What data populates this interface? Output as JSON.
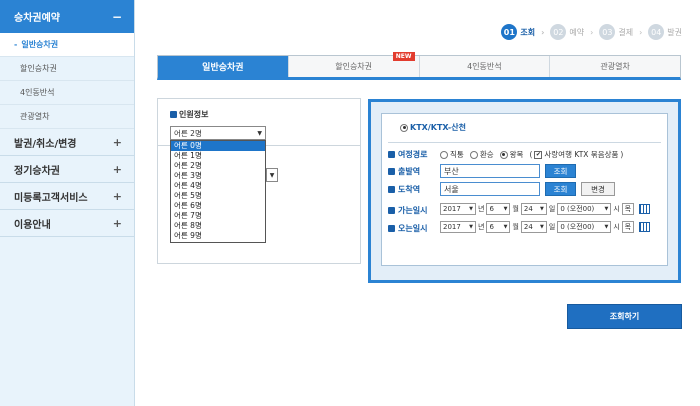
{
  "sidebar": {
    "header": {
      "label": "승차권예약",
      "sign": "−"
    },
    "subitems": [
      {
        "label": "일반승차권",
        "active": true
      },
      {
        "label": "할인승차권"
      },
      {
        "label": "4인동반석"
      },
      {
        "label": "관광열차"
      }
    ],
    "main_items": [
      {
        "label": "발권/취소/변경",
        "sign": "+"
      },
      {
        "label": "정기승차권",
        "sign": "+"
      },
      {
        "label": "미등록고객서비스",
        "sign": "+"
      },
      {
        "label": "이용안내",
        "sign": "+"
      }
    ]
  },
  "steps": [
    {
      "num": "01",
      "label": "조회",
      "active": true
    },
    {
      "num": "02",
      "label": "예약"
    },
    {
      "num": "03",
      "label": "결제"
    },
    {
      "num": "04",
      "label": "발권"
    }
  ],
  "step_arrow": "›",
  "tabs": [
    {
      "label": "일반승차권",
      "active": true
    },
    {
      "label": "할인승차권",
      "badge": "NEW"
    },
    {
      "label": "4인동반석"
    },
    {
      "label": "관광열차"
    }
  ],
  "passenger": {
    "title": "인원정보",
    "selected": "어른 2명",
    "options": [
      "어른 0명",
      "어른 1명",
      "어른 2명",
      "어른 3명",
      "어른 4명",
      "어른 5명",
      "어른 6명",
      "어른 7명",
      "어른 8명",
      "어른 9명"
    ],
    "highlighted_index": 0
  },
  "search_form": {
    "train_type": "KTX/KTX-산천",
    "route_label": "여정경로",
    "route_options": [
      "직통",
      "환승",
      "왕복"
    ],
    "route_selected": "왕복",
    "package_check_label": "사랑여행 KTX 묶음상품",
    "departure_label": "출발역",
    "departure_value": "부산",
    "arrival_label": "도착역",
    "arrival_value": "서울",
    "lookup_label": "조회",
    "change_label": "변경",
    "go_label": "가는일시",
    "return_label": "오는일시",
    "date_go": {
      "year": "2017",
      "month": "6",
      "day": "24",
      "hour": "0 (오전00)"
    },
    "date_return": {
      "year": "2017",
      "month": "6",
      "day": "24",
      "hour": "0 (오전00)"
    },
    "unit_year": "년",
    "unit_month": "월",
    "unit_day": "일",
    "unit_hour": "시",
    "weekday": "목"
  },
  "search_button": "조회하기",
  "colors": {
    "primary": "#2b83d3",
    "dark_blue": "#1a5fa8",
    "new_badge": "#e23c2e"
  }
}
